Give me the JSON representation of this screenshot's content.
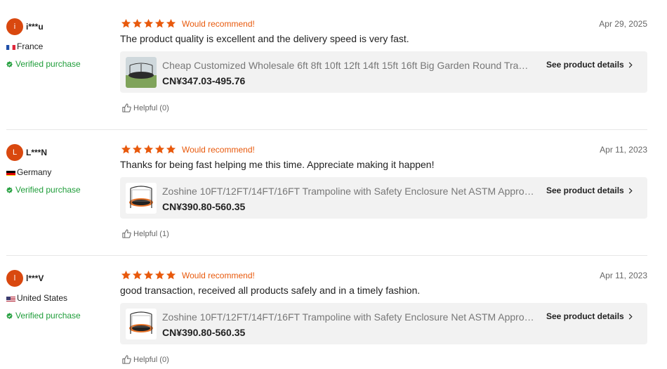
{
  "colors": {
    "accent": "#e8590c",
    "star": "#e8590c",
    "verified": "#1f9d3a",
    "avatar": "#d9480f",
    "card_bg": "#f2f2f2"
  },
  "reviews": [
    {
      "avatar_letter": "i",
      "user": "i***u",
      "country": "France",
      "flag_icon": "france-flag-icon",
      "verified_label": "Verified purchase",
      "rating": 5,
      "recommend_label": "Would recommend!",
      "date": "Apr 29, 2025",
      "text": "The product quality is excellent and the delivery speed is very fast.",
      "product": {
        "title": "Cheap Customized Wholesale 6ft 8ft 10ft 12ft 14ft 15ft 16ft Big Garden Round Trampoline",
        "price": "CN¥347.03-495.76",
        "details_label": "See product details"
      },
      "helpful_label": "Helpful (0)"
    },
    {
      "avatar_letter": "L",
      "user": "L***N",
      "country": "Germany",
      "flag_icon": "germany-flag-icon",
      "verified_label": "Verified purchase",
      "rating": 5,
      "recommend_label": "Would recommend!",
      "date": "Apr 11, 2023",
      "text": "Thanks for being fast helping me this time. Appreciate making it happen!",
      "product": {
        "title": "Zoshine 10FT/12FT/14FT/16FT Trampoline with Safety Enclosure Net ASTM Approved",
        "price": "CN¥390.80-560.35",
        "details_label": "See product details"
      },
      "helpful_label": "Helpful (1)"
    },
    {
      "avatar_letter": "l",
      "user": "l***V",
      "country": "United States",
      "flag_icon": "usa-flag-icon",
      "verified_label": "Verified purchase",
      "rating": 5,
      "recommend_label": "Would recommend!",
      "date": "Apr 11, 2023",
      "text": "good transaction, received all products safely and in a timely fashion.",
      "product": {
        "title": "Zoshine 10FT/12FT/14FT/16FT Trampoline with Safety Enclosure Net ASTM Approved",
        "price": "CN¥390.80-560.35",
        "details_label": "See product details"
      },
      "helpful_label": "Helpful (0)"
    }
  ]
}
